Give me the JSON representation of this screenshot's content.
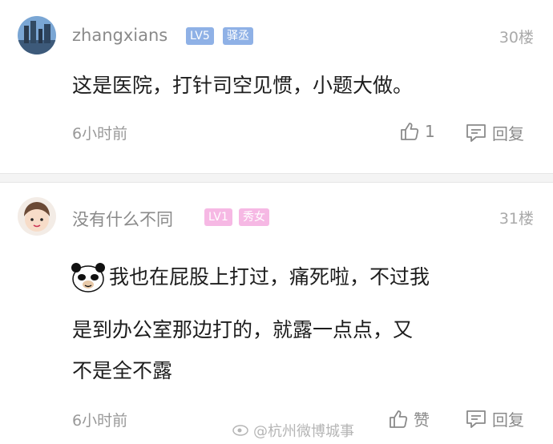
{
  "comments": [
    {
      "username": "zhangxians",
      "level": "LV5",
      "title": "驿丞",
      "floor": "30楼",
      "text": "这是医院，打针司空见惯，小题大做。",
      "time": "6小时前",
      "like_count": "1",
      "reply_label": "回复",
      "colors": {
        "level_badge": "#8fb1e6",
        "title_badge": "#8fb1e6"
      }
    },
    {
      "username": "没有什么不同",
      "level": "LV1",
      "title": "秀女",
      "floor": "31楼",
      "text_line1": "我也在屁股上打过，痛死啦，不过我",
      "text_line2": "是到办公室那边打的，就露一点点，又",
      "text_line3": "不是全不露",
      "time": "6小时前",
      "like_label": "赞",
      "reply_label": "回复",
      "colors": {
        "level_badge": "#f6b8e4",
        "title_badge": "#f6b8e4"
      }
    }
  ],
  "watermark": "@杭州微博城事",
  "icons": {
    "like": "thumbs-up-icon",
    "reply": "comment-bubble-icon",
    "sticker": "panda-face-icon"
  }
}
